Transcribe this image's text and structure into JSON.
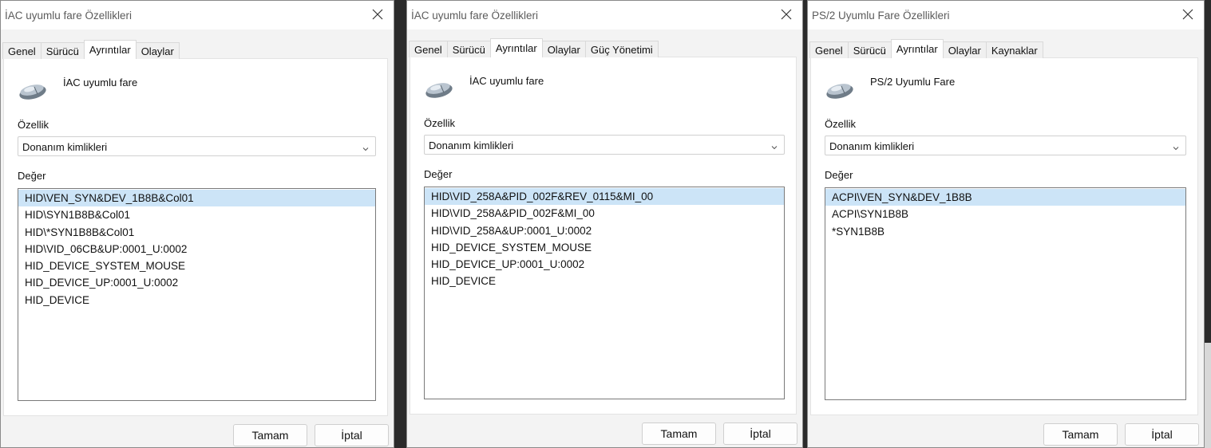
{
  "dialogs": [
    {
      "title": "İAC uyumlu fare Özellikleri",
      "tabs": [
        "Genel",
        "Sürücü",
        "Ayrıntılar",
        "Olaylar"
      ],
      "active_tab": "Ayrıntılar",
      "device_name": "İAC uyumlu fare",
      "property_label": "Özellik",
      "property_value": "Donanım kimlikleri",
      "value_label": "Değer",
      "values": [
        "HID\\VEN_SYN&DEV_1B8B&Col01",
        "HID\\SYN1B8B&Col01",
        "HID\\*SYN1B8B&Col01",
        "HID\\VID_06CB&UP:0001_U:0002",
        "HID_DEVICE_SYSTEM_MOUSE",
        "HID_DEVICE_UP:0001_U:0002",
        "HID_DEVICE"
      ],
      "selected_value": "HID\\VEN_SYN&DEV_1B8B&Col01",
      "ok_label": "Tamam",
      "cancel_label": "İptal"
    },
    {
      "title": "İAC uyumlu fare Özellikleri",
      "tabs": [
        "Genel",
        "Sürücü",
        "Ayrıntılar",
        "Olaylar",
        "Güç Yönetimi"
      ],
      "active_tab": "Ayrıntılar",
      "device_name": "İAC uyumlu fare",
      "property_label": "Özellik",
      "property_value": "Donanım kimlikleri",
      "value_label": "Değer",
      "values": [
        "HID\\VID_258A&PID_002F&REV_0115&MI_00",
        "HID\\VID_258A&PID_002F&MI_00",
        "HID\\VID_258A&UP:0001_U:0002",
        "HID_DEVICE_SYSTEM_MOUSE",
        "HID_DEVICE_UP:0001_U:0002",
        "HID_DEVICE"
      ],
      "selected_value": "HID\\VID_258A&PID_002F&REV_0115&MI_00",
      "ok_label": "Tamam",
      "cancel_label": "İptal"
    },
    {
      "title": "PS/2 Uyumlu Fare Özellikleri",
      "tabs": [
        "Genel",
        "Sürücü",
        "Ayrıntılar",
        "Olaylar",
        "Kaynaklar"
      ],
      "active_tab": "Ayrıntılar",
      "device_name": "PS/2 Uyumlu Fare",
      "property_label": "Özellik",
      "property_value": "Donanım kimlikleri",
      "value_label": "Değer",
      "values": [
        "ACPI\\VEN_SYN&DEV_1B8B",
        "ACPI\\SYN1B8B",
        "*SYN1B8B"
      ],
      "selected_value": "ACPI\\VEN_SYN&DEV_1B8B",
      "ok_label": "Tamam",
      "cancel_label": "İptal"
    }
  ],
  "icons": {
    "device": "mouse-icon",
    "close": "close-icon",
    "dropdown": "chevron-down-icon"
  },
  "colors": {
    "selection": "#cce4f7",
    "dialog_bg": "#f3f3f3",
    "panel_bg": "#ffffff"
  }
}
